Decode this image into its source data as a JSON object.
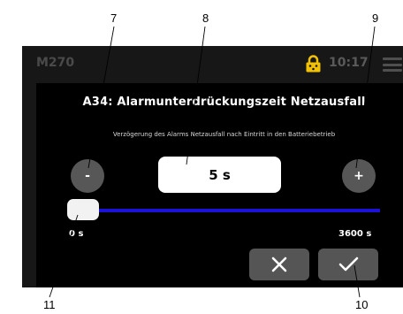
{
  "header": {
    "title": "M270",
    "time": "10:17"
  },
  "dialog": {
    "title": "A34: Alarmunterdrückungszeit Netzausfall",
    "description": "Verzögerung des Alarms Netzausfall nach Eintritt in den Batteriebetrieb",
    "decrement_label": "-",
    "increment_label": "+",
    "value": "5 s",
    "slider": {
      "min_label": "0 s",
      "max_label": "3600 s",
      "level_fraction": 0.0014
    }
  },
  "callouts": [
    "7",
    "8",
    "9",
    "11",
    "10"
  ],
  "colors": {
    "accent": "#1c12d6",
    "lock": "#f2c100"
  },
  "icons": {
    "lock": "lock-icon",
    "menu": "menu-icon",
    "cancel": "close-icon",
    "confirm": "check-icon"
  }
}
